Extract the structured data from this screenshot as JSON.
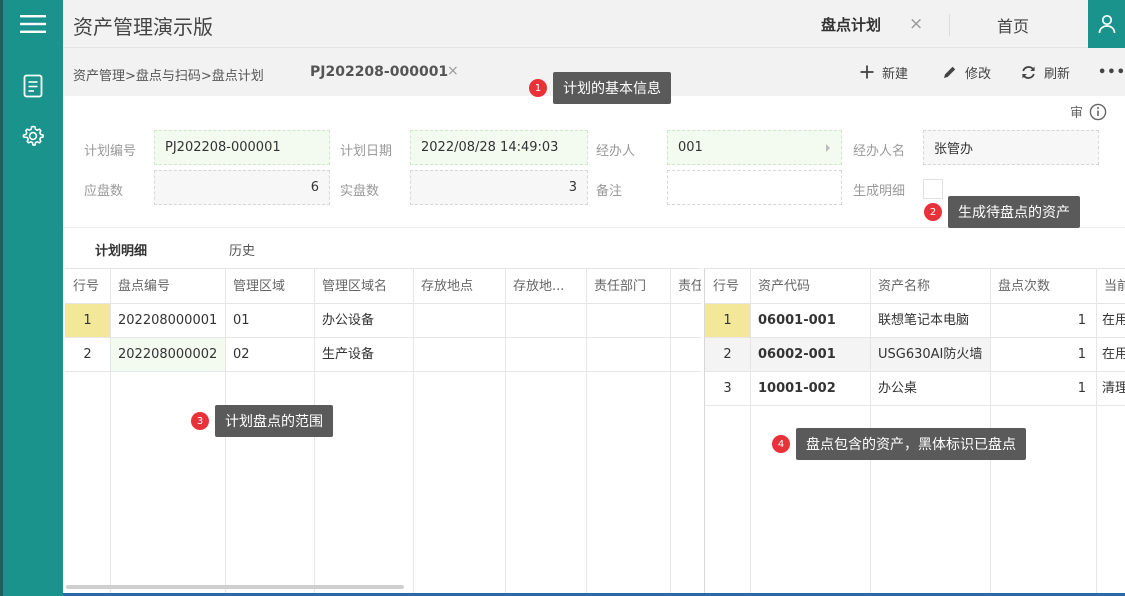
{
  "app": {
    "title": "资产管理演示版"
  },
  "tabs": [
    {
      "label": "盘点计划",
      "close": "×"
    },
    {
      "label": "首页"
    }
  ],
  "toolbar": {
    "breadcrumb": "资产管理>盘点与扫码>盘点计划",
    "doc_no": "PJ202208-000001",
    "doc_close": "×",
    "new_label": "新建",
    "edit_label": "修改",
    "refresh_label": "刷新",
    "more_label": "•••"
  },
  "callouts": [
    {
      "num": "1",
      "text": "计划的基本信息"
    },
    {
      "num": "2",
      "text": "生成待盘点的资产"
    },
    {
      "num": "3",
      "text": "计划盘点的范围"
    },
    {
      "num": "4",
      "text": "盘点包含的资产，黑体标识已盘点"
    }
  ],
  "form": {
    "audit_label": "审",
    "plan_no_label": "计划编号",
    "plan_no": "PJ202208-000001",
    "plan_date_label": "计划日期",
    "plan_date": "2022/08/28 14:49:03",
    "handler_label": "经办人",
    "handler": "001",
    "handler_name_label": "经办人名",
    "handler_name": "张管办",
    "expected_label": "应盘数",
    "expected": "6",
    "actual_label": "实盘数",
    "actual": "3",
    "remark_label": "备注",
    "remark": "",
    "gen_detail_label": "生成明细"
  },
  "detail_tabs": [
    {
      "label": "计划明细"
    },
    {
      "label": "历史"
    }
  ],
  "left_grid": {
    "headers": [
      "行号",
      "盘点编号",
      "管理区域",
      "管理区域名",
      "存放地点",
      "存放地...",
      "责任部门",
      "责任"
    ],
    "rows": [
      [
        "1",
        "202208000001",
        "01",
        "办公设备",
        "",
        "",
        "",
        ""
      ],
      [
        "2",
        "202208000002",
        "02",
        "生产设备",
        "",
        "",
        "",
        ""
      ]
    ]
  },
  "right_grid": {
    "headers": [
      "行号",
      "资产代码",
      "资产名称",
      "盘点次数",
      "当前"
    ],
    "rows": [
      [
        "1",
        "06001-001",
        "联想笔记本电脑",
        "1",
        "在用"
      ],
      [
        "2",
        "06002-001",
        "USG630AI防火墙",
        "1",
        "在用"
      ],
      [
        "3",
        "10001-002",
        "办公桌",
        "1",
        "清理"
      ]
    ]
  },
  "colors": {
    "sidebar": "#19938b",
    "callout_badge": "#e8323a",
    "callout_bg": "#5a5a5a",
    "row_highlight": "#f3e89a"
  }
}
